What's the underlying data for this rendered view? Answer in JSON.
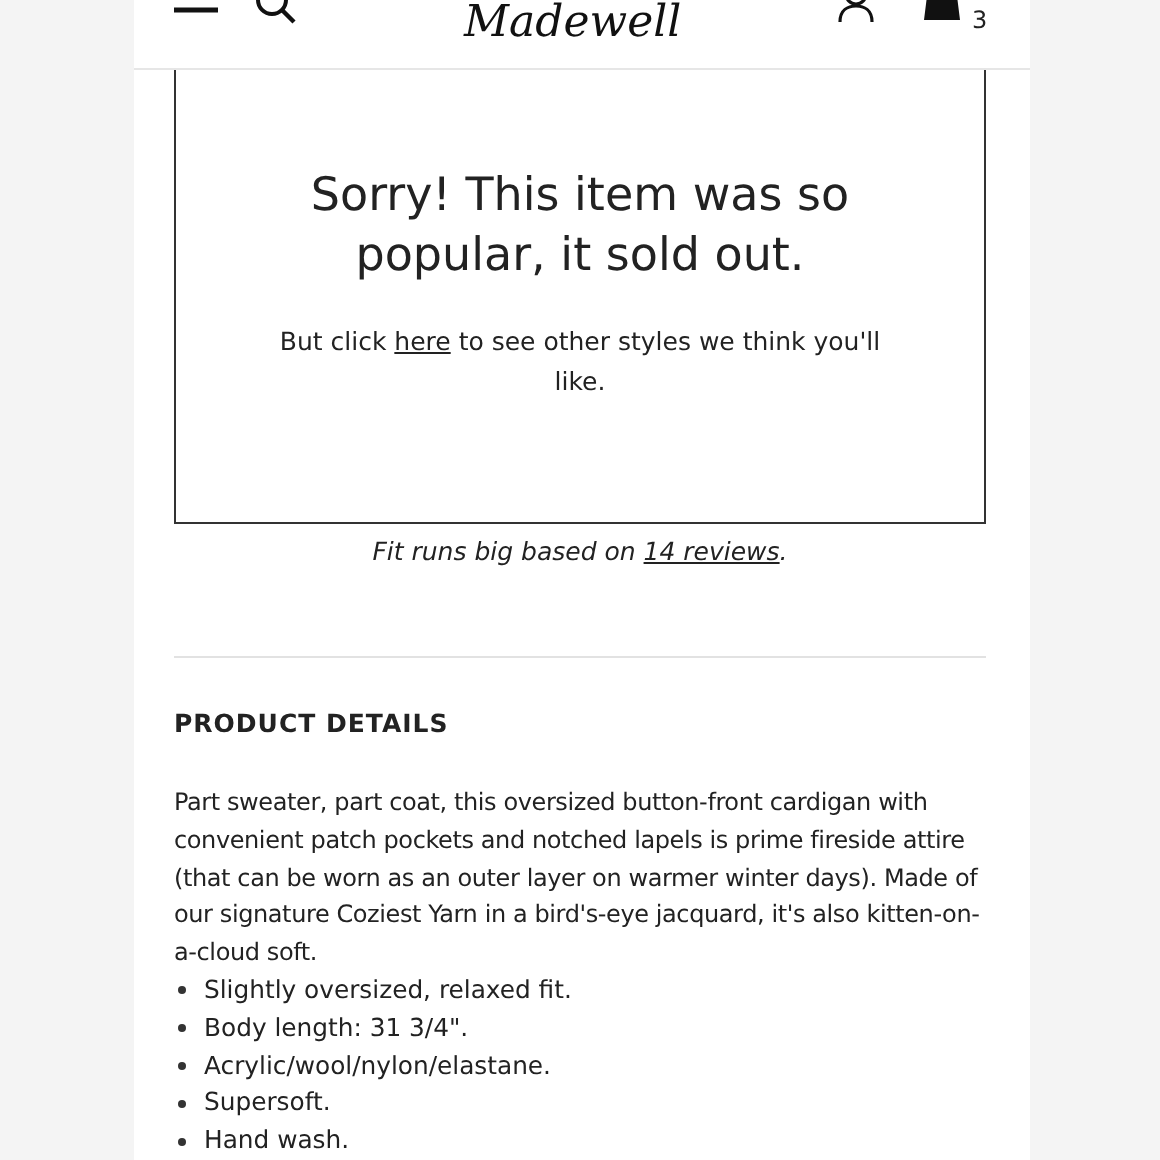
{
  "header": {
    "logo": "Madewell",
    "cart_count": "3"
  },
  "sold_out": {
    "title": "Sorry! This item was so popular, it sold out.",
    "message_before": "But click ",
    "link": "here",
    "message_after": " to see other styles we think you'll like."
  },
  "fit_note": {
    "before": "Fit runs big based on ",
    "link": "14 reviews",
    "after": "."
  },
  "product_details": {
    "heading": "PRODUCT DETAILS",
    "description": "Part sweater, part coat, this oversized button-front cardigan with convenient patch pockets and notched lapels is prime fireside attire (that can be worn as an outer layer on warmer winter days). Made of our signature Coziest Yarn in a bird's-eye jacquard, it's also kitten-on-a-cloud soft.",
    "bullets": [
      "Slightly oversized, relaxed fit.",
      "Body length: 31 3/4\".",
      "Acrylic/wool/nylon/elastane.",
      "Supersoft.",
      "Hand wash."
    ]
  }
}
